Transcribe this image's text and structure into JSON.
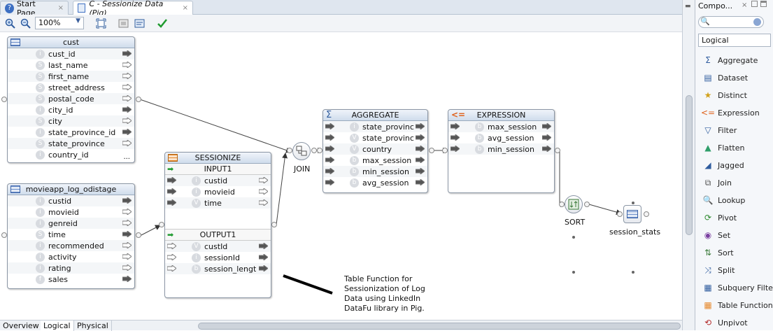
{
  "tabs": [
    {
      "label": "Start Page",
      "close": "×"
    },
    {
      "label": "C - Sessionize Data (Pig)",
      "close": "×"
    }
  ],
  "toolbar": {
    "zoom": "100%",
    "zoom_in_icon": "zoom-in-icon",
    "zoom_out_icon": "zoom-out-icon"
  },
  "nodes": {
    "cust": {
      "title": "cust",
      "rows": [
        {
          "badge": "i",
          "label": "cust_id"
        },
        {
          "badge": "S",
          "label": "last_name"
        },
        {
          "badge": "S",
          "label": "first_name"
        },
        {
          "badge": "S",
          "label": "street_address"
        },
        {
          "badge": "S",
          "label": "postal_code"
        },
        {
          "badge": "i",
          "label": "city_id"
        },
        {
          "badge": "S",
          "label": "city"
        },
        {
          "badge": "i",
          "label": "state_province_id"
        },
        {
          "badge": "S",
          "label": "state_province"
        },
        {
          "badge": "i",
          "label": "country_id"
        }
      ],
      "more": "..."
    },
    "movieapp": {
      "title": "movieapp_log_odistage",
      "rows": [
        {
          "badge": "i",
          "label": "custid"
        },
        {
          "badge": "i",
          "label": "movieid"
        },
        {
          "badge": "i",
          "label": "genreid"
        },
        {
          "badge": "S",
          "label": "time"
        },
        {
          "badge": "i",
          "label": "recommended"
        },
        {
          "badge": "i",
          "label": "activity"
        },
        {
          "badge": "i",
          "label": "rating"
        },
        {
          "badge": "f",
          "label": "sales"
        }
      ]
    },
    "sessionize": {
      "title": "SESSIONIZE",
      "input_title": "INPUT1",
      "input_rows": [
        {
          "badge": "i",
          "label": "custid"
        },
        {
          "badge": "i",
          "label": "movieid"
        },
        {
          "badge": "V",
          "label": "time"
        }
      ],
      "output_title": "OUTPUT1",
      "output_rows": [
        {
          "badge": "V",
          "label": "custId"
        },
        {
          "badge": "i",
          "label": "sessionId"
        },
        {
          "badge": "b",
          "label": "session_lengt"
        }
      ]
    },
    "aggregate": {
      "title": "AGGREGATE",
      "rows": [
        {
          "badge": "i",
          "label": "state_provinc"
        },
        {
          "badge": "V",
          "label": "state_provinc"
        },
        {
          "badge": "V",
          "label": "country"
        },
        {
          "badge": "b",
          "label": "max_session"
        },
        {
          "badge": "b",
          "label": "min_session"
        },
        {
          "badge": "b",
          "label": "avg_session"
        }
      ]
    },
    "expression": {
      "title": "EXPRESSION",
      "rows": [
        {
          "badge": "b",
          "label": "max_session"
        },
        {
          "badge": "b",
          "label": "avg_session"
        },
        {
          "badge": "b",
          "label": "min_session"
        }
      ]
    },
    "join_label": "JOIN",
    "sort_label": "SORT",
    "target_label": "session_stats"
  },
  "note": "Table Function for\nSessionization of Log\nData using LinkedIn\nDataFu library in Pig.",
  "bottom_tabs": [
    "Overview",
    "Logical",
    "Physical"
  ],
  "panel": {
    "title": "Compo...",
    "category": "Logical",
    "items": [
      {
        "icon": "aggregate-icon",
        "label": "Aggregate"
      },
      {
        "icon": "dataset-icon",
        "label": "Dataset"
      },
      {
        "icon": "distinct-icon",
        "label": "Distinct"
      },
      {
        "icon": "expression-icon",
        "label": "Expression"
      },
      {
        "icon": "filter-icon",
        "label": "Filter"
      },
      {
        "icon": "flatten-icon",
        "label": "Flatten"
      },
      {
        "icon": "jagged-icon",
        "label": "Jagged"
      },
      {
        "icon": "join-icon",
        "label": "Join"
      },
      {
        "icon": "lookup-icon",
        "label": "Lookup"
      },
      {
        "icon": "pivot-icon",
        "label": "Pivot"
      },
      {
        "icon": "set-icon",
        "label": "Set"
      },
      {
        "icon": "sort-icon",
        "label": "Sort"
      },
      {
        "icon": "split-icon",
        "label": "Split"
      },
      {
        "icon": "subquery-filter-icon",
        "label": "Subquery Filter"
      },
      {
        "icon": "table-function-icon",
        "label": "Table Function"
      },
      {
        "icon": "unpivot-icon",
        "label": "Unpivot"
      }
    ]
  }
}
